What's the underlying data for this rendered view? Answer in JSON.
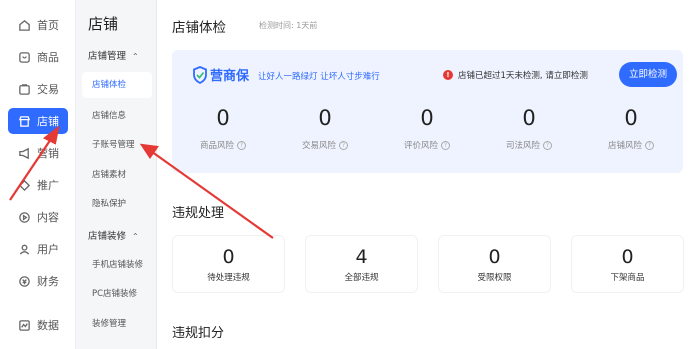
{
  "nav": {
    "items": [
      {
        "label": "首页",
        "icon": "home-icon"
      },
      {
        "label": "商品",
        "icon": "product-icon"
      },
      {
        "label": "交易",
        "icon": "trade-icon"
      },
      {
        "label": "店铺",
        "icon": "shop-icon",
        "active": true
      },
      {
        "label": "营销",
        "icon": "marketing-icon"
      },
      {
        "label": "推广",
        "icon": "promotion-icon"
      },
      {
        "label": "内容",
        "icon": "content-icon"
      },
      {
        "label": "用户",
        "icon": "user-icon"
      },
      {
        "label": "财务",
        "icon": "finance-icon"
      },
      {
        "label": "数据",
        "icon": "data-icon"
      }
    ]
  },
  "menu": {
    "title": "店铺",
    "group1": {
      "label": "店铺管理",
      "items": [
        "店铺体检",
        "店铺信息",
        "子账号管理",
        "店铺素材",
        "隐私保护"
      ]
    },
    "group2": {
      "label": "店铺装修",
      "items": [
        "手机店铺装修",
        "PC店铺装修",
        "装修管理"
      ]
    }
  },
  "main": {
    "title": "店铺体检",
    "subtitle": "检测时间: 1天前",
    "panel": {
      "brand": "营商保",
      "slogan": "让好人一路绿灯 让坏人寸步难行",
      "warning": "店铺已超过1天未检测, 请立即检测",
      "check_button": "立即检测",
      "risks": [
        {
          "value": "0",
          "label": "商品风险"
        },
        {
          "value": "0",
          "label": "交易风险"
        },
        {
          "value": "0",
          "label": "评价风险"
        },
        {
          "value": "0",
          "label": "司法风险"
        },
        {
          "value": "0",
          "label": "店铺风险"
        }
      ]
    },
    "violation_title": "违规处理",
    "violations": [
      {
        "value": "0",
        "label": "待处理违规"
      },
      {
        "value": "4",
        "label": "全部违规"
      },
      {
        "value": "0",
        "label": "受限权限"
      },
      {
        "value": "0",
        "label": "下架商品"
      }
    ],
    "deduction_title": "违规扣分"
  },
  "colors": {
    "accent": "#2f6bff",
    "panel_bg": "#eef3ff",
    "arrow": "#e53935",
    "warning": "#e53935"
  }
}
